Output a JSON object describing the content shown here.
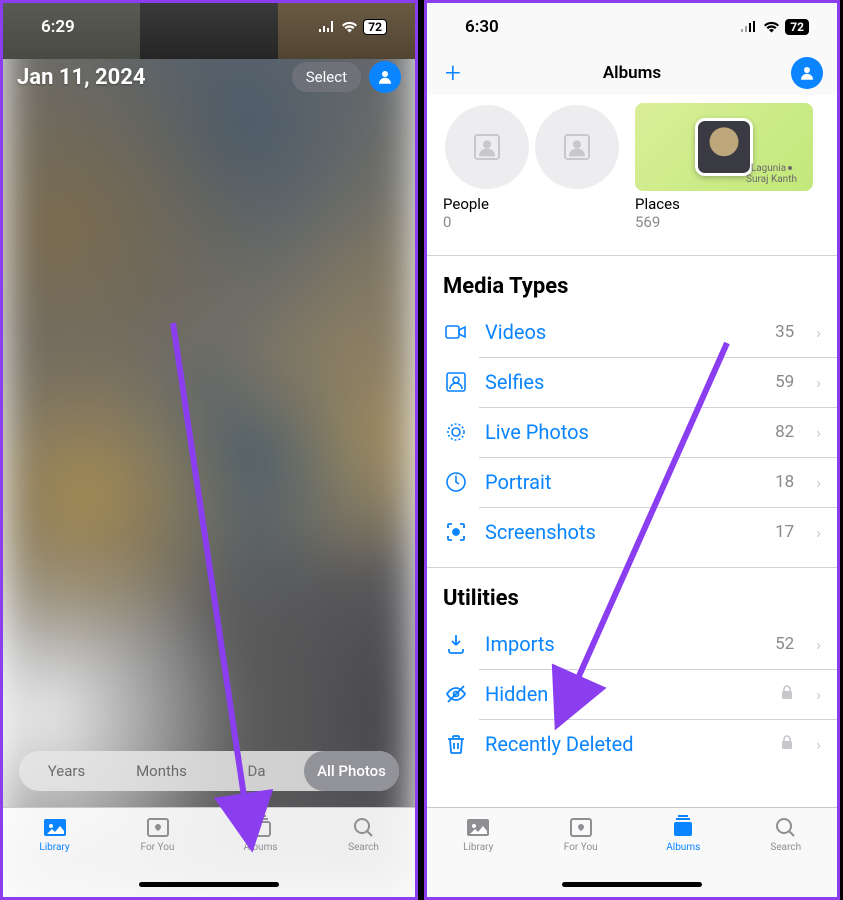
{
  "left": {
    "status": {
      "time": "6:29",
      "battery": "72"
    },
    "header": {
      "date": "Jan 11, 2024",
      "select_label": "Select"
    },
    "view_modes": {
      "years": "Years",
      "months": "Months",
      "days": "Da",
      "all": "All Photos"
    },
    "tabs": {
      "library": "Library",
      "for_you": "For You",
      "albums": "Albums",
      "search": "Search"
    }
  },
  "right": {
    "status": {
      "time": "6:30",
      "battery": "72"
    },
    "nav": {
      "title": "Albums"
    },
    "people_places": {
      "people_label": "People",
      "people_count": "0",
      "places_label": "Places",
      "places_count": "569",
      "places_map_label1": "Lagunia",
      "places_map_label2": "Suraj Kanth"
    },
    "sections": {
      "media_types": {
        "title": "Media Types",
        "items": [
          {
            "label": "Videos",
            "count": "35"
          },
          {
            "label": "Selfies",
            "count": "59"
          },
          {
            "label": "Live Photos",
            "count": "82"
          },
          {
            "label": "Portrait",
            "count": "18"
          },
          {
            "label": "Screenshots",
            "count": "17"
          }
        ]
      },
      "utilities": {
        "title": "Utilities",
        "items": [
          {
            "label": "Imports",
            "count": "52"
          },
          {
            "label": "Hidden",
            "locked": true
          },
          {
            "label": "Recently Deleted",
            "locked": true
          }
        ]
      }
    },
    "tabs": {
      "library": "Library",
      "for_you": "For You",
      "albums": "Albums",
      "search": "Search"
    }
  }
}
